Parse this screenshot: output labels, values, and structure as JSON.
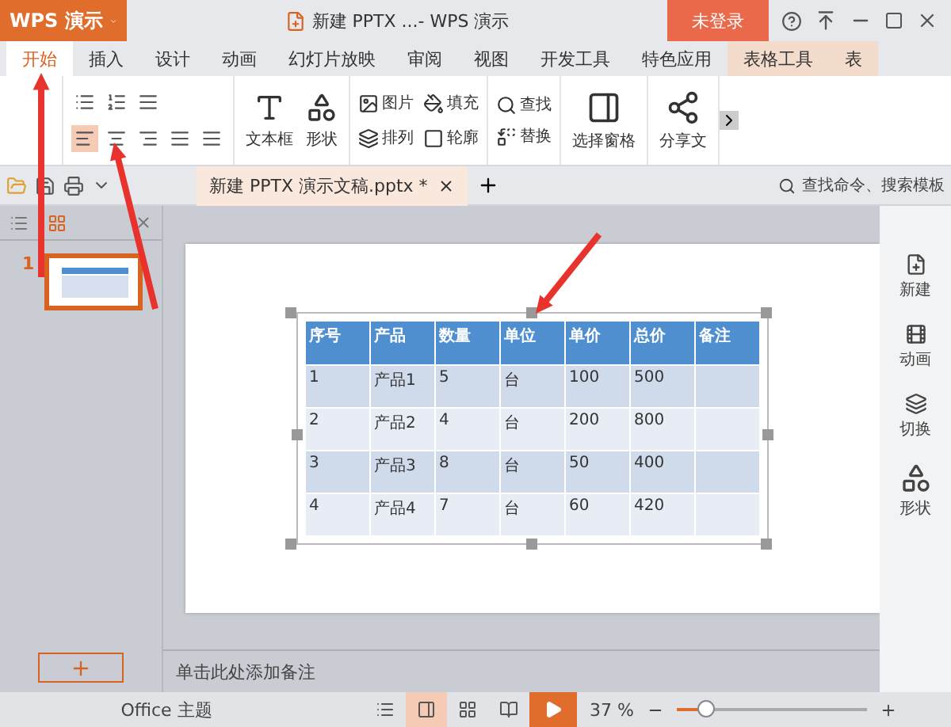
{
  "app_button": {
    "label": "WPS 演示"
  },
  "window": {
    "title": "新建 PPTX ...- WPS 演示"
  },
  "login_button": {
    "label": "未登录"
  },
  "tabs": [
    {
      "label": "开始",
      "selected": true,
      "contextual": false
    },
    {
      "label": "插入",
      "selected": false,
      "contextual": false
    },
    {
      "label": "设计",
      "selected": false,
      "contextual": false
    },
    {
      "label": "动画",
      "selected": false,
      "contextual": false
    },
    {
      "label": "幻灯片放映",
      "selected": false,
      "contextual": false
    },
    {
      "label": "审阅",
      "selected": false,
      "contextual": false
    },
    {
      "label": "视图",
      "selected": false,
      "contextual": false
    },
    {
      "label": "开发工具",
      "selected": false,
      "contextual": false
    },
    {
      "label": "特色应用",
      "selected": false,
      "contextual": false
    },
    {
      "label": "表格工具",
      "selected": false,
      "contextual": true
    },
    {
      "label": "表",
      "selected": false,
      "contextual": true
    }
  ],
  "alignment": [
    {
      "kind": "left",
      "selected": true
    },
    {
      "kind": "center",
      "selected": false
    },
    {
      "kind": "right",
      "selected": false
    },
    {
      "kind": "justify",
      "selected": false
    },
    {
      "kind": "distribute",
      "selected": false
    }
  ],
  "ribbon": {
    "large_buttons": [
      {
        "label": "文本框",
        "kind": "textbox"
      },
      {
        "label": "形状",
        "kind": "shape"
      }
    ],
    "small_buttons": [
      {
        "label": "图片",
        "kind": "picture"
      },
      {
        "label": "填充",
        "kind": "fill"
      },
      {
        "label": "排列",
        "kind": "arrange"
      },
      {
        "label": "轮廓",
        "kind": "outline"
      }
    ],
    "find_buttons": [
      {
        "label": "查找",
        "kind": "find"
      },
      {
        "label": "替换",
        "kind": "replace"
      }
    ],
    "tool_buttons": [
      {
        "label": "选择窗格",
        "kind": "pane"
      },
      {
        "label": "分享文",
        "kind": "share"
      }
    ]
  },
  "document_tab": {
    "title": "新建 PPTX 演示文稿.pptx *"
  },
  "search": {
    "placeholder": "查找命令、搜索模板"
  },
  "slides": [
    {
      "number": "1",
      "selected": true
    }
  ],
  "table": {
    "columns": [
      "序号",
      "产品",
      "数量",
      "单位",
      "单价",
      "总价",
      "备注"
    ],
    "rows": [
      [
        "1",
        "产品1",
        "5",
        "台",
        "100",
        "500",
        ""
      ],
      [
        "2",
        "产品2",
        "4",
        "台",
        "200",
        "800",
        ""
      ],
      [
        "3",
        "产品3",
        "8",
        "台",
        "50",
        "400",
        ""
      ],
      [
        "4",
        "产品4",
        "7",
        "台",
        "60",
        "420",
        ""
      ]
    ]
  },
  "notes": {
    "placeholder": "单击此处添加备注"
  },
  "side_panel": {
    "items": [
      {
        "label": "新建",
        "kind": "new"
      },
      {
        "label": "动画",
        "kind": "animation"
      },
      {
        "label": "切换",
        "kind": "transition"
      },
      {
        "label": "形状",
        "kind": "shape"
      }
    ]
  },
  "status_bar": {
    "theme": "Office 主题",
    "zoom": "37 %",
    "zoom_slider": {
      "level": 0.15
    }
  }
}
